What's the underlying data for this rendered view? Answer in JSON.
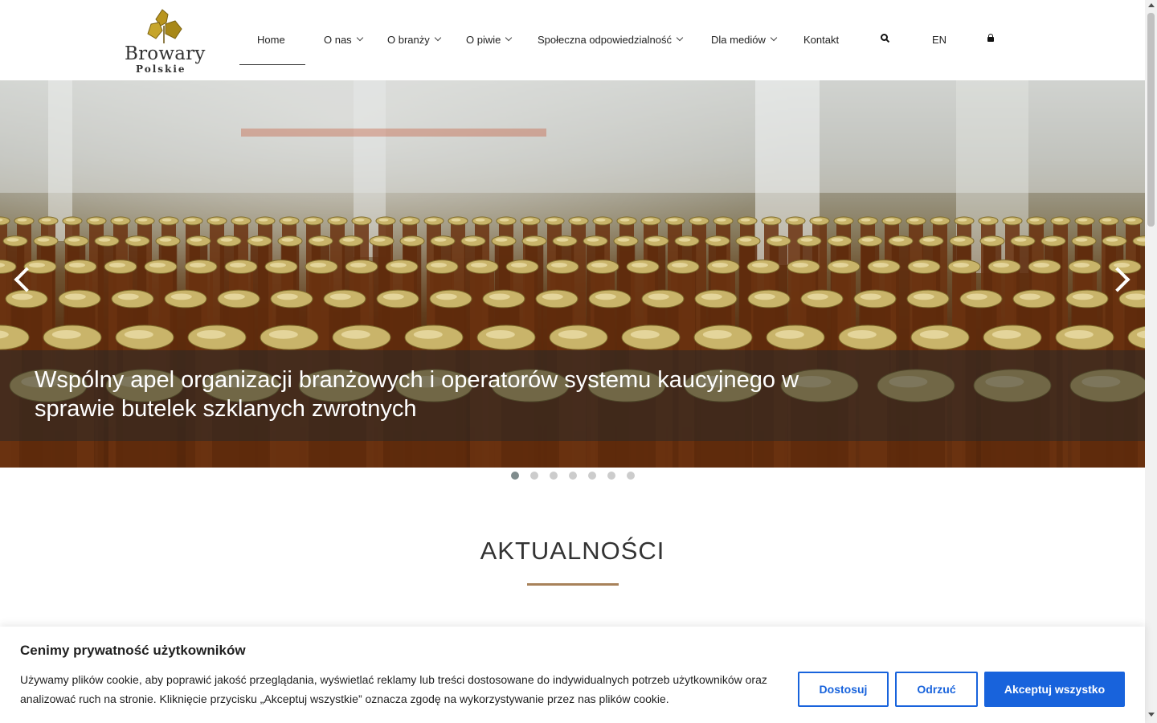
{
  "logo": {
    "line1": "Browary",
    "line2": "Polskie",
    "leaf_color": "#b9951f"
  },
  "nav": {
    "items": [
      {
        "label": "Home",
        "dropdown": false,
        "active": true
      },
      {
        "label": "O nas",
        "dropdown": true
      },
      {
        "label": "O branży",
        "dropdown": true
      },
      {
        "label": "O piwie",
        "dropdown": true
      },
      {
        "label": "Społeczna odpowiedzialność",
        "dropdown": true
      },
      {
        "label": "Dla mediów",
        "dropdown": true
      },
      {
        "label": "Kontakt",
        "dropdown": false
      }
    ],
    "search_icon": "search-icon",
    "language": "EN",
    "lock_icon": "lock-icon"
  },
  "hero": {
    "title": "Wspólny apel organizacji branżowych i operatorów systemu kaucyjnego w sprawie butelek szklanych zwrotnych",
    "prev_icon": "chevron-left-icon",
    "next_icon": "chevron-right-icon",
    "slide_count": 7,
    "active_slide": 1
  },
  "section": {
    "title": "AKTUALNOŚCI",
    "accent_color": "#a8825a"
  },
  "cookie": {
    "title": "Cenimy prywatność użytkowników",
    "text": "Używamy plików cookie, aby poprawić jakość przeglądania, wyświetlać reklamy lub treści dostosowane do indywidualnych potrzeb użytkowników oraz analizować ruch na stronie. Kliknięcie przycisku „Akceptuj wszystkie” oznacza zgodę na wykorzystywanie przez nas plików cookie.",
    "customize_label": "Dostosuj",
    "reject_label": "Odrzuć",
    "accept_label": "Akceptuj wszystko",
    "brand_color": "#1863dc"
  }
}
